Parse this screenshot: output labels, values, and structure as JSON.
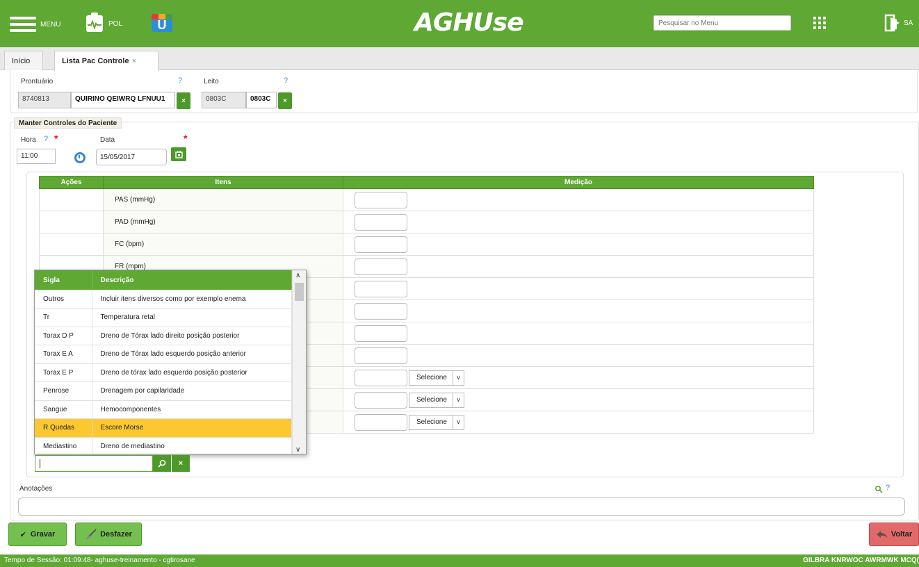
{
  "header": {
    "menu_label": "MENU",
    "pol_label": "POL",
    "u_letter": "U",
    "logo": "AGHUse",
    "search_placeholder": "Pesquisar no Menu",
    "exit_label": "SA"
  },
  "tabs": [
    {
      "label": "Início"
    },
    {
      "label": "Lista Pac Controle",
      "close": "×"
    }
  ],
  "patient": {
    "prontuario_label": "Prontuário",
    "prontuario_value": "8740813",
    "name_value": "QUIRINO QEIWRQ LFNUU1",
    "leito_label": "Leito",
    "leito_value": "0803C",
    "leito_bold": "0803C",
    "help": "?",
    "clear": "×"
  },
  "form": {
    "legend": "Manter Controles do Paciente",
    "hora_label": "Hora",
    "hora_value": "11:00",
    "data_label": "Data",
    "data_value": "15/05/2017",
    "required": "*",
    "help": "?"
  },
  "table": {
    "headers": [
      "Ações",
      "Itens",
      "Medição"
    ],
    "items": [
      "PAS (mmHg)",
      "PAD (mmHg)",
      "FC (bpm)",
      "FR (mpm)"
    ],
    "select_label": "Selecione"
  },
  "dropdown": {
    "headers": [
      "Sigla",
      "Descrição"
    ],
    "rows": [
      {
        "sigla": "Outros",
        "desc": "Incluir itens diversos como por exemplo enema"
      },
      {
        "sigla": "Tr",
        "desc": "Temperatura retal"
      },
      {
        "sigla": "Torax D P",
        "desc": "Dreno de Tórax lado direito posição posterior"
      },
      {
        "sigla": "Torax E A",
        "desc": "Dreno de Tórax lado esquerdo posição anterior"
      },
      {
        "sigla": "Torax E P",
        "desc": "Dreno de tórax lado esquerdo posição posterior"
      },
      {
        "sigla": "Penrose",
        "desc": "Drenagem por capilaridade"
      },
      {
        "sigla": "Sangue",
        "desc": "Hemocomponentes"
      },
      {
        "sigla": "R Quedas",
        "desc": "Escore Morse",
        "highlighted": true
      },
      {
        "sigla": "Mediastino",
        "desc": "Dreno de mediastino"
      }
    ],
    "highlight_color": "#fdc72f"
  },
  "annotations": {
    "label": "Anotações",
    "help": "?"
  },
  "buttons": {
    "save": "Gravar",
    "undo": "Desfazer",
    "back": "Voltar"
  },
  "status": {
    "session": "Tempo de Sessão: 01:09:48- aghuse-treinamento - cgtirosane",
    "user": "GILBRA KNRWOC AWRMWK MCQ("
  },
  "colors": {
    "brand_green": "#5ea833",
    "button_green": "#74c04e",
    "back_red": "#e06a6a"
  }
}
